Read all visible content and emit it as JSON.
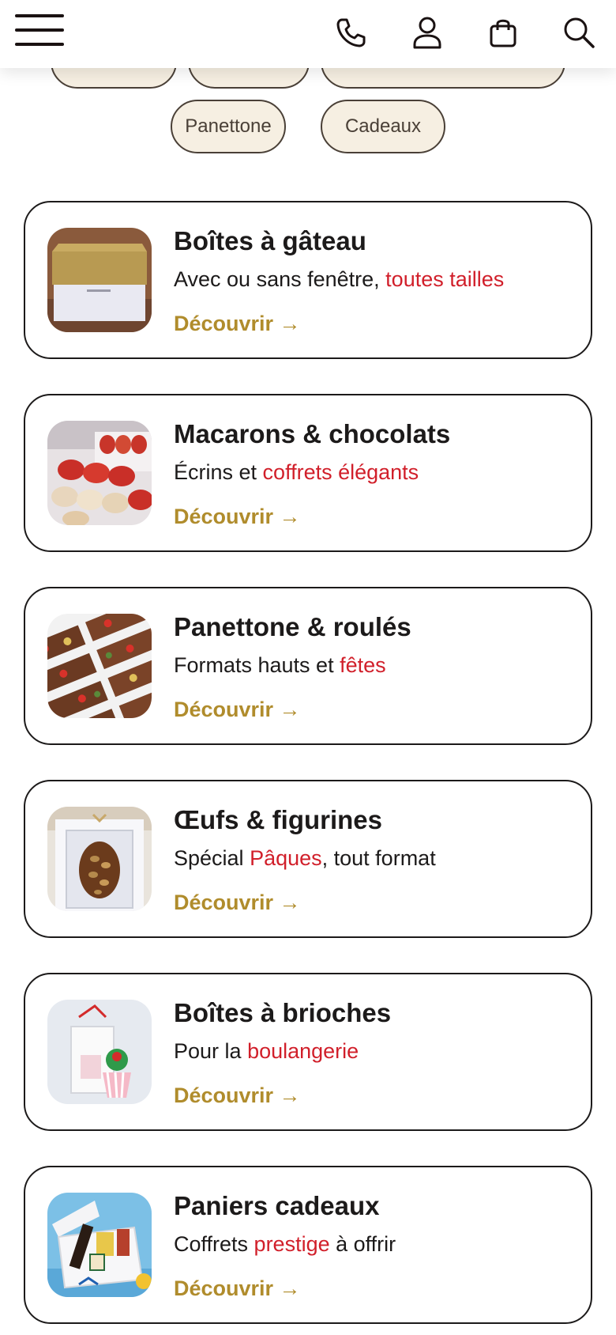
{
  "header": {
    "menu_icon": "hamburger-menu-icon",
    "phone_icon": "phone-icon",
    "account_icon": "user-icon",
    "cart_icon": "shopping-bag-icon",
    "search_icon": "search-icon"
  },
  "filters": [
    "Panettone",
    "Cadeaux"
  ],
  "cards": [
    {
      "title": "Boîtes à gâteau",
      "sub_before": "Avec ou sans fenêtre, ",
      "sub_highlight": "toutes tailles",
      "sub_after": "",
      "link": "Découvrir →"
    },
    {
      "title": "Macarons & chocolats",
      "sub_before": "Écrins et ",
      "sub_highlight": "coffrets élégants",
      "sub_after": "",
      "link": "Découvrir →"
    },
    {
      "title": "Panettone & roulés",
      "sub_before": "Formats hauts et ",
      "sub_highlight": "fêtes",
      "sub_after": "",
      "link": "Découvrir →"
    },
    {
      "title": "Œufs & figurines",
      "sub_before": "Spécial ",
      "sub_highlight": "Pâques",
      "sub_after": ", tout format",
      "link": "Découvrir →"
    },
    {
      "title": "Boîtes à brioches",
      "sub_before": "Pour la ",
      "sub_highlight": "boulangerie",
      "sub_after": "",
      "link": "Découvrir →"
    },
    {
      "title": "Paniers cadeaux",
      "sub_before": "Coffrets ",
      "sub_highlight": "prestige",
      "sub_after": " à offrir",
      "link": "Découvrir →"
    }
  ],
  "colors": {
    "accent_link": "#b08c2c",
    "highlight_red": "#d11f2a",
    "pill_bg": "#f6efe2",
    "pill_border": "#4a4037"
  }
}
